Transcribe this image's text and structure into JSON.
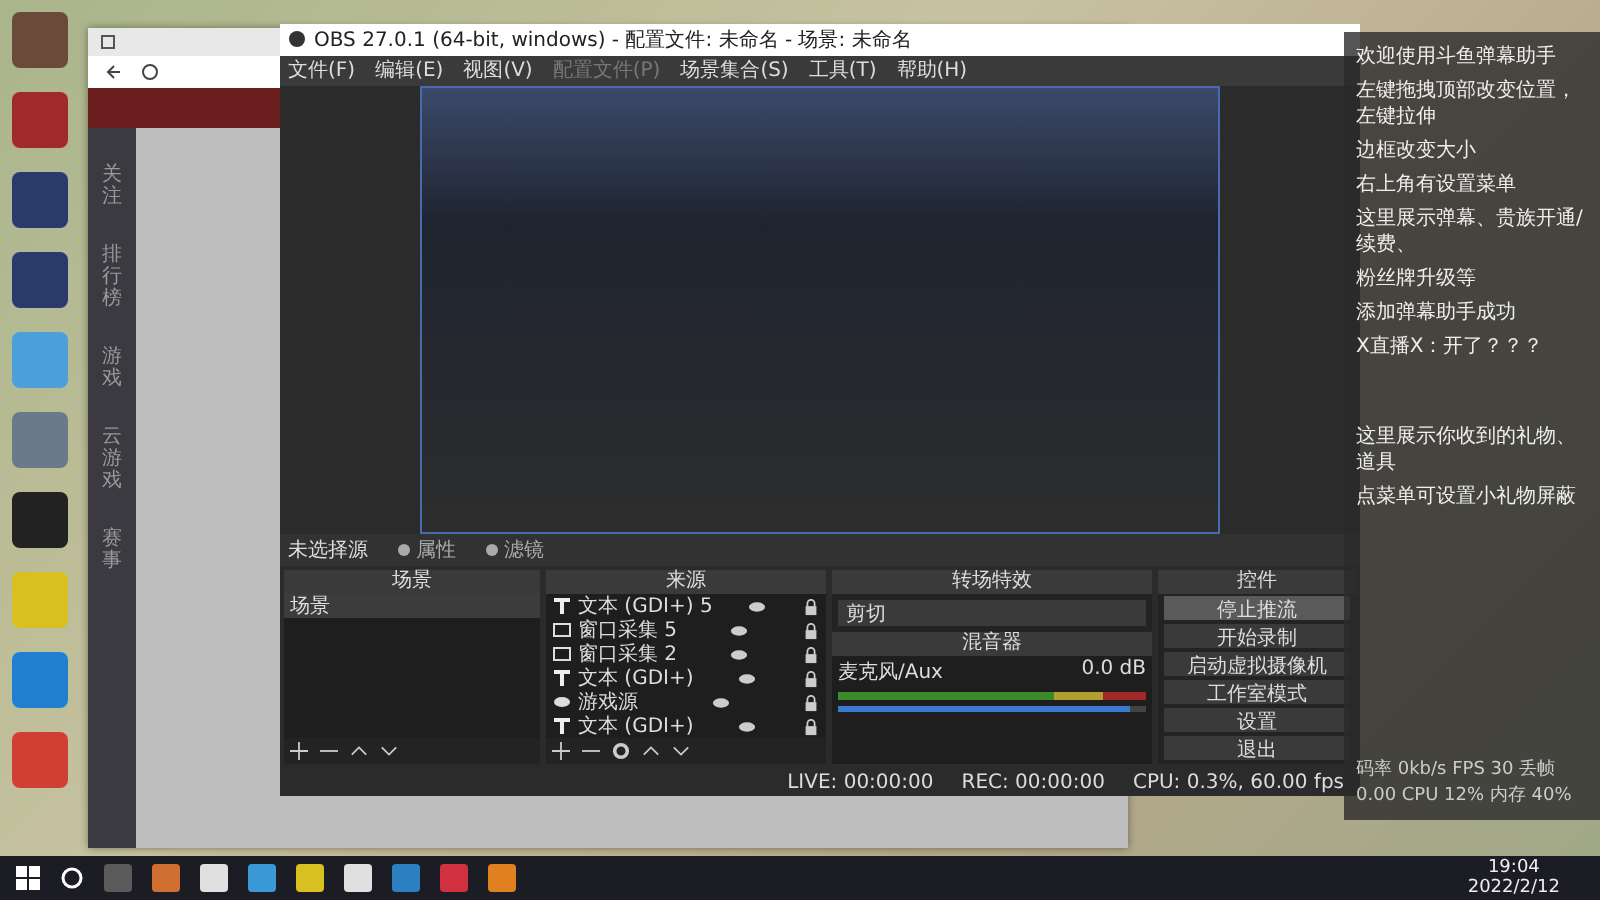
{
  "browser": {
    "nav": [
      "关注",
      "排行榜",
      "游戏",
      "云游戏",
      "赛事"
    ]
  },
  "obs": {
    "title": "OBS 27.0.1 (64-bit, windows) - 配置文件: 未命名 - 场景: 未命名",
    "menu": [
      {
        "label": "文件(F)",
        "disabled": false
      },
      {
        "label": "编辑(E)",
        "disabled": false
      },
      {
        "label": "视图(V)",
        "disabled": false
      },
      {
        "label": "配置文件(P)",
        "disabled": true
      },
      {
        "label": "场景集合(S)",
        "disabled": false
      },
      {
        "label": "工具(T)",
        "disabled": false
      },
      {
        "label": "帮助(H)",
        "disabled": false
      }
    ],
    "source_bar": {
      "label": "未选择源",
      "buttons": [
        "属性",
        "滤镜"
      ]
    },
    "scenes": {
      "title": "场景",
      "items": [
        {
          "label": "场景",
          "selected": true
        }
      ]
    },
    "sources": {
      "title": "来源",
      "items": [
        {
          "kind": "text",
          "label": "文本 (GDI+) 5"
        },
        {
          "kind": "window",
          "label": "窗口采集 5"
        },
        {
          "kind": "window",
          "label": "窗口采集 2"
        },
        {
          "kind": "text",
          "label": "文本 (GDI+)"
        },
        {
          "kind": "game",
          "label": "游戏源"
        },
        {
          "kind": "text",
          "label": "文本 (GDI+)"
        }
      ]
    },
    "transitions": {
      "title": "转场特效",
      "value": "剪切"
    },
    "mixer": {
      "title": "混音器",
      "channel": "麦克风/Aux",
      "reading": "0.0 dB",
      "level": 0.95
    },
    "controls": {
      "title": "控件",
      "buttons": [
        {
          "label": "停止推流",
          "selected": true
        },
        {
          "label": "开始录制",
          "selected": false
        },
        {
          "label": "启动虚拟摄像机",
          "selected": false
        },
        {
          "label": "工作室模式",
          "selected": false
        },
        {
          "label": "设置",
          "selected": false
        },
        {
          "label": "退出",
          "selected": false
        }
      ]
    },
    "status": [
      "LIVE: 00:00:00",
      "REC: 00:00:00",
      "CPU: 0.3%, 60.00 fps"
    ]
  },
  "danmaku": {
    "messages": [
      "欢迎使用斗鱼弹幕助手",
      "左键拖拽顶部改变位置，左键拉伸",
      "边框改变大小",
      "右上角有设置菜单",
      "这里展示弹幕、贵族开通/续费、",
      "粉丝牌升级等",
      "添加弹幕助手成功",
      "X直播X：开了？？？"
    ],
    "gifts": [
      "这里展示你收到的礼物、道具",
      "点菜单可设置小礼物屏蔽"
    ],
    "stats": "码率 0kb/s FPS 30 丢帧 0.00 CPU 12% 内存 40%"
  },
  "taskbar": {
    "time": "19:04",
    "date": "2022/2/12"
  }
}
